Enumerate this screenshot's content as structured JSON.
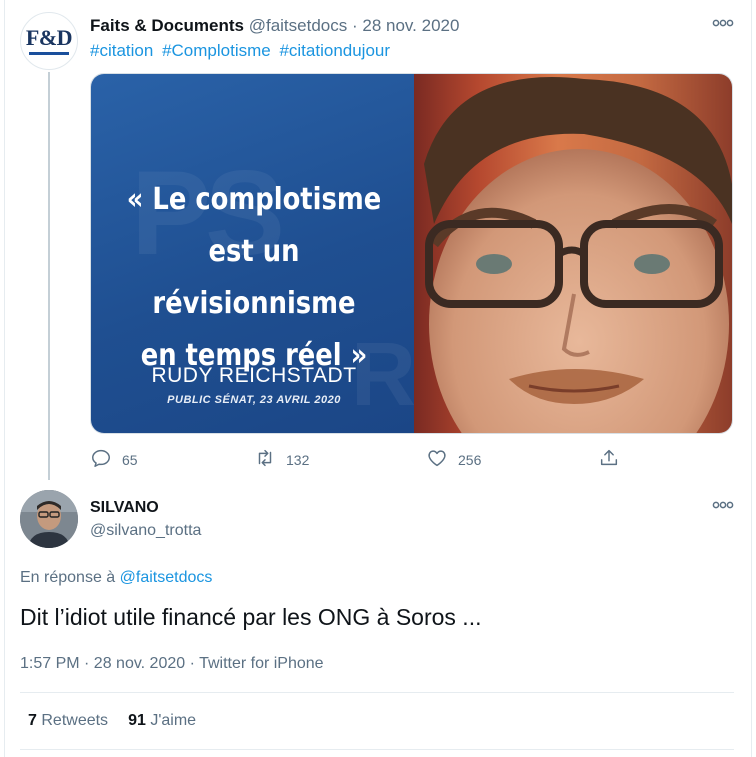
{
  "tweet1": {
    "avatar_text": "F&D",
    "display_name": "Faits & Documents",
    "handle": "@faitsetdocs",
    "separator": "·",
    "date": "28 nov. 2020",
    "hashtags": [
      "#citation",
      "#Complotisme",
      "#citationdujour"
    ],
    "media": {
      "quote_lines": [
        "« Le complotisme",
        "est un révisionnisme",
        "en temps réel »"
      ],
      "author": "RUDY REICHSTADT",
      "source": "PUBLIC SÉNAT, 23 AVRIL 2020"
    },
    "actions": {
      "reply_count": "65",
      "retweet_count": "132",
      "like_count": "256"
    }
  },
  "tweet2": {
    "display_name": "SILVANO",
    "handle": "@silvano_trotta",
    "reply_prefix": "En réponse à",
    "reply_mention": "@faitsetdocs",
    "text": "Dit l’idiot utile financé par les ONG à Soros ...",
    "meta": "1:57 PM · 28 nov. 2020 · Twitter for iPhone",
    "retweets_count": "7",
    "retweets_label": "Retweets",
    "likes_count": "91",
    "likes_label": "J'aime"
  },
  "colors": {
    "link": "#1b95e0",
    "secondary_text": "#5b7083",
    "primary_text": "#0f1419",
    "image_blue": "#1f4f91"
  },
  "icons": [
    "more-icon",
    "reply-icon",
    "retweet-icon",
    "like-icon",
    "share-icon"
  ]
}
